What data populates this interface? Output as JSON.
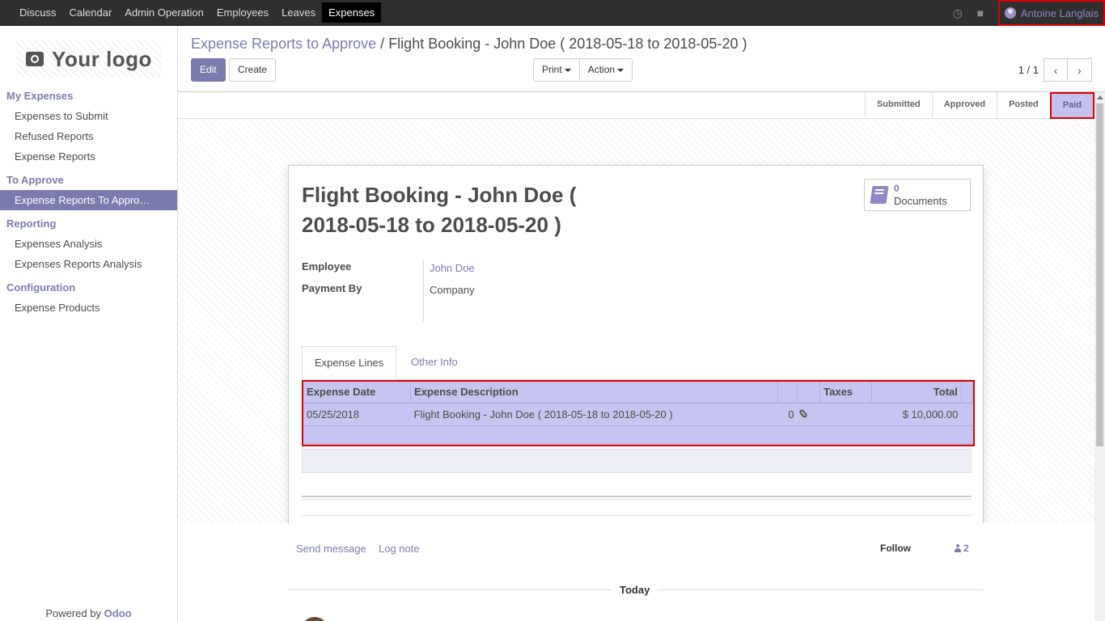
{
  "topbar": {
    "menu": [
      "Discuss",
      "Calendar",
      "Admin Operation",
      "Employees",
      "Leaves",
      "Expenses"
    ],
    "active": "Expenses",
    "user": "Antoine Langlais"
  },
  "sidebar": {
    "logo_text": "Your logo",
    "sections": [
      {
        "title": "My Expenses",
        "items": [
          "Expenses to Submit",
          "Refused Reports",
          "Expense Reports"
        ]
      },
      {
        "title": "To Approve",
        "items": [
          "Expense Reports To Appro…"
        ]
      },
      {
        "title": "Reporting",
        "items": [
          "Expenses Analysis",
          "Expenses Reports Analysis"
        ]
      },
      {
        "title": "Configuration",
        "items": [
          "Expense Products"
        ]
      }
    ],
    "powered_prefix": "Powered by ",
    "powered_brand": "Odoo"
  },
  "control": {
    "breadcrumb_parent": "Expense Reports to Approve",
    "breadcrumb_sep": "/",
    "breadcrumb_current": "Flight Booking - John Doe ( 2018-05-18 to 2018-05-20 )",
    "edit_label": "Edit",
    "create_label": "Create",
    "print_label": "Print",
    "action_label": "Action",
    "pager_value": "1 / 1"
  },
  "status": {
    "stages": [
      "Submitted",
      "Approved",
      "Posted",
      "Paid"
    ],
    "current": "Paid"
  },
  "form": {
    "title": "Flight Booking - John Doe ( 2018-05-18 to 2018-05-20 )",
    "doc_count": "0",
    "doc_label": "Documents",
    "employee_label": "Employee",
    "employee_value": "John Doe",
    "payment_label": "Payment By",
    "payment_value": "Company",
    "tabs": [
      "Expense Lines",
      "Other Info"
    ],
    "lines": {
      "headers": [
        "Expense Date",
        "Expense Description",
        "",
        "",
        "Taxes",
        "Total"
      ],
      "rows": [
        {
          "date": "05/25/2018",
          "description": "Flight Booking - John Doe ( 2018-05-18 to 2018-05-20 )",
          "qty": "0",
          "taxes": "",
          "total": "$ 10,000.00"
        }
      ]
    }
  },
  "chatter": {
    "send_message": "Send message",
    "log_note": "Log note",
    "follow": "Follow",
    "followers": "2",
    "today": "Today"
  },
  "icons": {
    "clock": "clock-icon",
    "chat": "chat-icon",
    "book": "book-icon",
    "paperclip": "paperclip-icon",
    "person": "person-icon"
  },
  "colors": {
    "brand": "#7c7bad",
    "highlight": "#c6c4f0",
    "annotation": "#e00000"
  }
}
